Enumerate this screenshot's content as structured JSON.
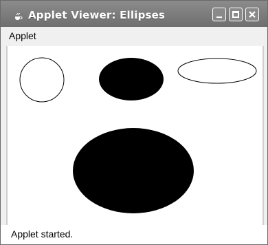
{
  "window": {
    "title": "Applet Viewer: Ellipses",
    "icon": "java-cup-icon",
    "controls": [
      "minimize-icon",
      "maximize-icon",
      "close-icon"
    ]
  },
  "menubar": {
    "items": [
      {
        "label": "Applet"
      }
    ]
  },
  "canvas": {
    "shapes": [
      {
        "name": "circle-outline",
        "kind": "ellipse-outline",
        "stroke": "#000000",
        "fill": "none"
      },
      {
        "name": "ellipse-filled-small",
        "kind": "ellipse-filled",
        "fill": "#000000"
      },
      {
        "name": "ellipse-outline-wide",
        "kind": "ellipse-outline",
        "stroke": "#000000",
        "fill": "none"
      },
      {
        "name": "ellipse-filled-large",
        "kind": "ellipse-filled",
        "fill": "#000000"
      }
    ]
  },
  "status": {
    "text": "Applet started."
  },
  "colors": {
    "titlebar": "#7a7a7a",
    "menubar": "#f0f0f0",
    "canvas": "#ffffff",
    "shape": "#000000"
  }
}
